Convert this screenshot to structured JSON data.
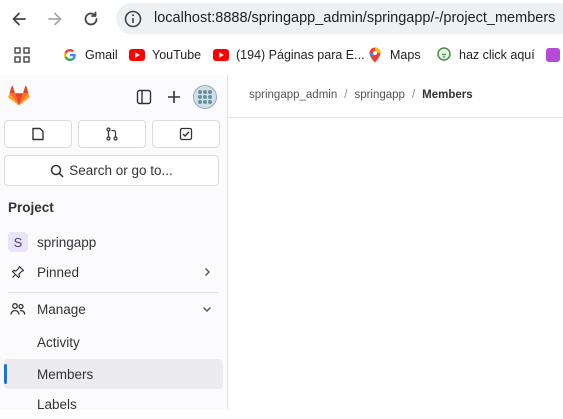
{
  "browser": {
    "url": "localhost:8888/springapp_admin/springapp/-/project_members",
    "bookmarks": [
      {
        "label": "Gmail",
        "icon": "google-icon"
      },
      {
        "label": "YouTube",
        "icon": "youtube-icon"
      },
      {
        "label": "(194) Páginas para E...",
        "icon": "youtube-icon"
      },
      {
        "label": "Maps",
        "icon": "maps-pin-icon"
      },
      {
        "label": "haz click aquí",
        "icon": "bulb-icon"
      }
    ]
  },
  "sidebar": {
    "search_label": "Search or go to...",
    "section_title": "Project",
    "project_initial": "S",
    "project_name": "springapp",
    "pinned_label": "Pinned",
    "manage_label": "Manage",
    "items": [
      {
        "label": "Activity"
      },
      {
        "label": "Members",
        "active": true
      },
      {
        "label": "Labels"
      }
    ]
  },
  "breadcrumb": {
    "items": [
      "springapp_admin",
      "springapp",
      "Members"
    ]
  },
  "colors": {
    "gitlab_orange": "#fc6d26",
    "active_bar": "#1f75cb",
    "project_badge": "#e9e4f8"
  }
}
